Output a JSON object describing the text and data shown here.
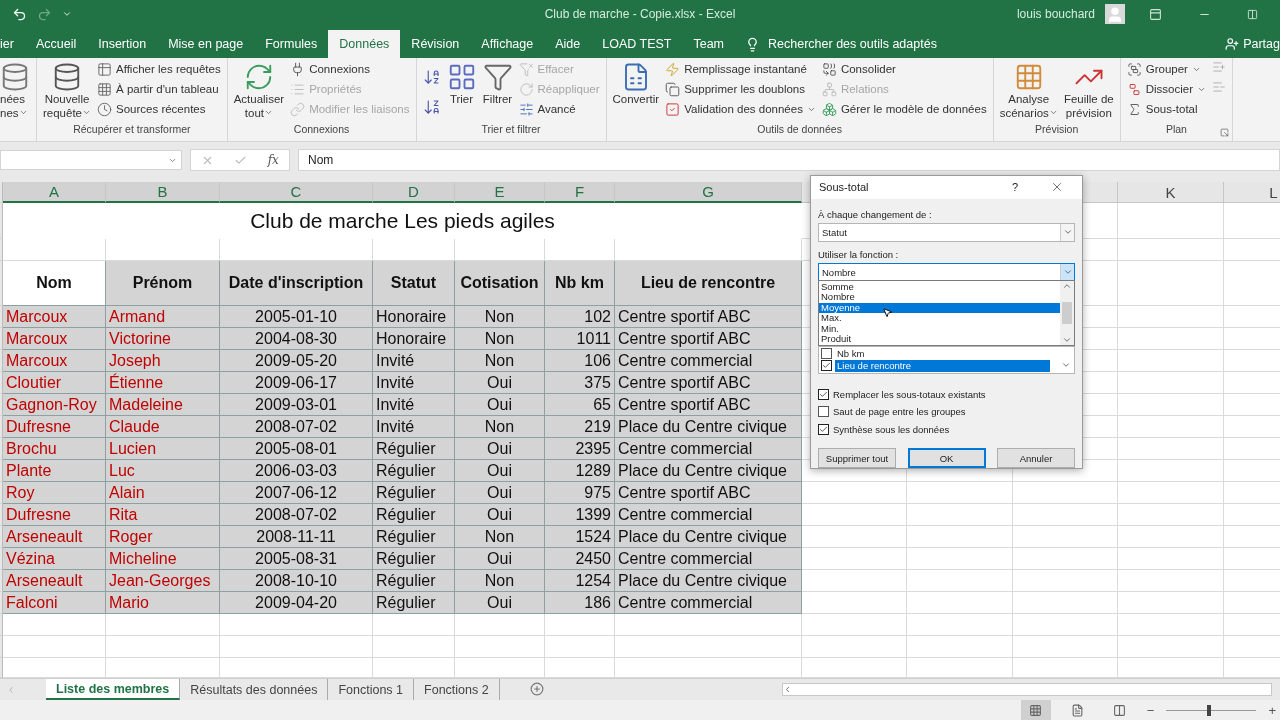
{
  "titlebar": {
    "title": "Club de marche - Copie.xlsx  -  Excel",
    "user": "louis bouchard"
  },
  "tabs": [
    {
      "label": "ier",
      "selected": false
    },
    {
      "label": "Accueil",
      "selected": false
    },
    {
      "label": "Insertion",
      "selected": false
    },
    {
      "label": "Mise en page",
      "selected": false
    },
    {
      "label": "Formules",
      "selected": false
    },
    {
      "label": "Données",
      "selected": true
    },
    {
      "label": "Révision",
      "selected": false
    },
    {
      "label": "Affichage",
      "selected": false
    },
    {
      "label": "Aide",
      "selected": false
    },
    {
      "label": "LOAD TEST",
      "selected": false
    },
    {
      "label": "Team",
      "selected": false
    }
  ],
  "tell_me": "Rechercher des outils adaptés",
  "share": "Partag",
  "ribbon": {
    "groups": [
      {
        "controls": [
          {
            "kind": "large",
            "lines": [
              "nées",
              "nes"
            ],
            "dropdown": true
          }
        ]
      },
      {
        "label": "Récupérer et transformer",
        "controls": [
          {
            "kind": "large",
            "lines": [
              "Nouvelle",
              "requête"
            ],
            "dropdown": true
          },
          {
            "kind": "stack",
            "items": [
              {
                "label": "Afficher les requêtes",
                "disabled": false
              },
              {
                "label": "À partir d'un tableau",
                "disabled": false
              },
              {
                "label": "Sources récentes",
                "disabled": false
              }
            ]
          }
        ]
      },
      {
        "label": "Connexions",
        "controls": [
          {
            "kind": "large",
            "lines": [
              "Actualiser",
              "tout"
            ],
            "dropdown": true
          },
          {
            "kind": "stack",
            "items": [
              {
                "label": "Connexions",
                "disabled": false
              },
              {
                "label": "Propriétés",
                "disabled": true
              },
              {
                "label": "Modifier les liaisons",
                "disabled": true
              }
            ]
          }
        ]
      },
      {
        "label": "Trier et filtrer",
        "controls": [
          {
            "kind": "sort"
          },
          {
            "kind": "large",
            "lines": [
              "Trier"
            ]
          },
          {
            "kind": "large",
            "lines": [
              "Filtrer"
            ]
          },
          {
            "kind": "stack",
            "items": [
              {
                "label": "Effacer",
                "disabled": true
              },
              {
                "label": "Réappliquer",
                "disabled": true
              },
              {
                "label": "Avancé",
                "disabled": false
              }
            ]
          }
        ]
      },
      {
        "label": "Outils de données",
        "controls": [
          {
            "kind": "large",
            "lines": [
              "Convertir"
            ]
          },
          {
            "kind": "stack",
            "items": [
              {
                "label": "Remplissage instantané",
                "disabled": false
              },
              {
                "label": "Supprimer les doublons",
                "disabled": false
              },
              {
                "label": "Validation des données",
                "disabled": false,
                "dropdown": true
              }
            ]
          },
          {
            "kind": "stack",
            "items": [
              {
                "label": "Consolider",
                "disabled": false
              },
              {
                "label": "Relations",
                "disabled": true
              },
              {
                "label": "Gérer le modèle de données",
                "disabled": false
              }
            ]
          }
        ]
      },
      {
        "label": "Prévision",
        "controls": [
          {
            "kind": "large",
            "lines": [
              "Analyse",
              "scénarios"
            ],
            "dropdown": true
          },
          {
            "kind": "large",
            "lines": [
              "Feuille de",
              "prévision"
            ]
          }
        ]
      },
      {
        "label": "Plan",
        "launcher": true,
        "controls": [
          {
            "kind": "stack",
            "items": [
              {
                "label": "Grouper",
                "disabled": false,
                "dropdown": true
              },
              {
                "label": "Dissocier",
                "disabled": false,
                "dropdown": true
              },
              {
                "label": "Sous-total",
                "disabled": false
              }
            ]
          },
          {
            "kind": "tools"
          }
        ]
      }
    ]
  },
  "formula_bar": {
    "fx": "fx",
    "value": "Nom"
  },
  "columns": [
    {
      "letter": "A",
      "selected": true
    },
    {
      "letter": "B",
      "selected": true
    },
    {
      "letter": "C",
      "selected": true
    },
    {
      "letter": "D",
      "selected": true
    },
    {
      "letter": "E",
      "selected": true
    },
    {
      "letter": "F",
      "selected": true
    },
    {
      "letter": "G",
      "selected": true
    },
    {
      "letter": "K",
      "selected": false
    },
    {
      "letter": "L",
      "selected": false
    }
  ],
  "sheet": {
    "title": "Club de marche Les pieds agiles",
    "header": [
      {
        "text": "Nom",
        "active": true
      },
      {
        "text": "Prénom",
        "active": false
      },
      {
        "text": "Date d'inscription",
        "active": false
      },
      {
        "text": "Statut",
        "active": false
      },
      {
        "text": "Cotisation",
        "active": false
      },
      {
        "text": "Nb km",
        "active": false
      },
      {
        "text": "Lieu de rencontre",
        "active": false
      }
    ],
    "rows": [
      [
        "Marcoux",
        "Armand",
        "2005-01-10",
        "Honoraire",
        "Non",
        "102",
        "Centre sportif ABC"
      ],
      [
        "Marcoux",
        "Victorine",
        "2004-08-30",
        "Honoraire",
        "Non",
        "1011",
        "Centre sportif ABC"
      ],
      [
        "Marcoux",
        "Joseph",
        "2009-05-20",
        "Invité",
        "Non",
        "106",
        "Centre commercial"
      ],
      [
        "Cloutier",
        "Étienne",
        "2009-06-17",
        "Invité",
        "Oui",
        "375",
        "Centre sportif ABC"
      ],
      [
        "Gagnon-Roy",
        "Madeleine",
        "2009-03-01",
        "Invité",
        "Oui",
        "65",
        "Centre sportif ABC"
      ],
      [
        "Dufresne",
        "Claude",
        "2008-07-02",
        "Invité",
        "Non",
        "219",
        "Place du Centre civique"
      ],
      [
        "Brochu",
        "Lucien",
        "2005-08-01",
        "Régulier",
        "Oui",
        "2395",
        "Centre commercial"
      ],
      [
        "Plante",
        "Luc",
        "2006-03-03",
        "Régulier",
        "Oui",
        "1289",
        "Place du Centre civique"
      ],
      [
        "Roy",
        "Alain",
        "2007-06-12",
        "Régulier",
        "Oui",
        "975",
        "Centre sportif ABC"
      ],
      [
        "Dufresne",
        "Rita",
        "2008-07-02",
        "Régulier",
        "Oui",
        "1399",
        "Centre commercial"
      ],
      [
        "Arseneault",
        "Roger",
        "2008-11-11",
        "Régulier",
        "Non",
        "1524",
        "Place du Centre civique"
      ],
      [
        "Vézina",
        "Micheline",
        "2005-08-31",
        "Régulier",
        "Oui",
        "2450",
        "Centre commercial"
      ],
      [
        "Arseneault",
        "Jean-Georges",
        "2008-10-10",
        "Régulier",
        "Non",
        "1254",
        "Place du Centre civique"
      ],
      [
        "Falconi",
        "Mario",
        "2009-04-20",
        "Régulier",
        "Oui",
        "186",
        "Centre commercial"
      ]
    ]
  },
  "dialog": {
    "title": "Sous-total",
    "help": "?",
    "change_label": "À chaque changement de :",
    "change_value": "Statut",
    "function_label": "Utiliser la fonction :",
    "function_value": "Nombre",
    "function_options": [
      {
        "label": "Somme",
        "selected": false
      },
      {
        "label": "Nombre",
        "selected": false
      },
      {
        "label": "Moyenne",
        "selected": true
      },
      {
        "label": "Max.",
        "selected": false
      },
      {
        "label": "Min.",
        "selected": false
      },
      {
        "label": "Produit",
        "selected": false
      }
    ],
    "subtotal_columns": [
      {
        "label": "Nb km",
        "checked": false,
        "selected": false
      },
      {
        "label": "Lieu de rencontre",
        "checked": true,
        "selected": true
      }
    ],
    "options": [
      {
        "label": "Remplacer les sous-totaux existants",
        "checked": true
      },
      {
        "label": "Saut de page entre les groupes",
        "checked": false
      },
      {
        "label": "Synthèse sous les données",
        "checked": true
      }
    ],
    "buttons": [
      {
        "label": "Supprimer tout",
        "default": false
      },
      {
        "label": "OK",
        "default": true
      },
      {
        "label": "Annuler",
        "default": false
      }
    ]
  },
  "sheet_tabs": [
    {
      "label": "Liste des membres",
      "selected": true
    },
    {
      "label": "Résultats des données",
      "selected": false
    },
    {
      "label": "Fonctions 1",
      "selected": false
    },
    {
      "label": "Fonctions 2",
      "selected": false
    }
  ],
  "status_bar": {
    "zoom_out": "−",
    "zoom_in": "+",
    "zoom": {
      "level": 0.45
    }
  }
}
